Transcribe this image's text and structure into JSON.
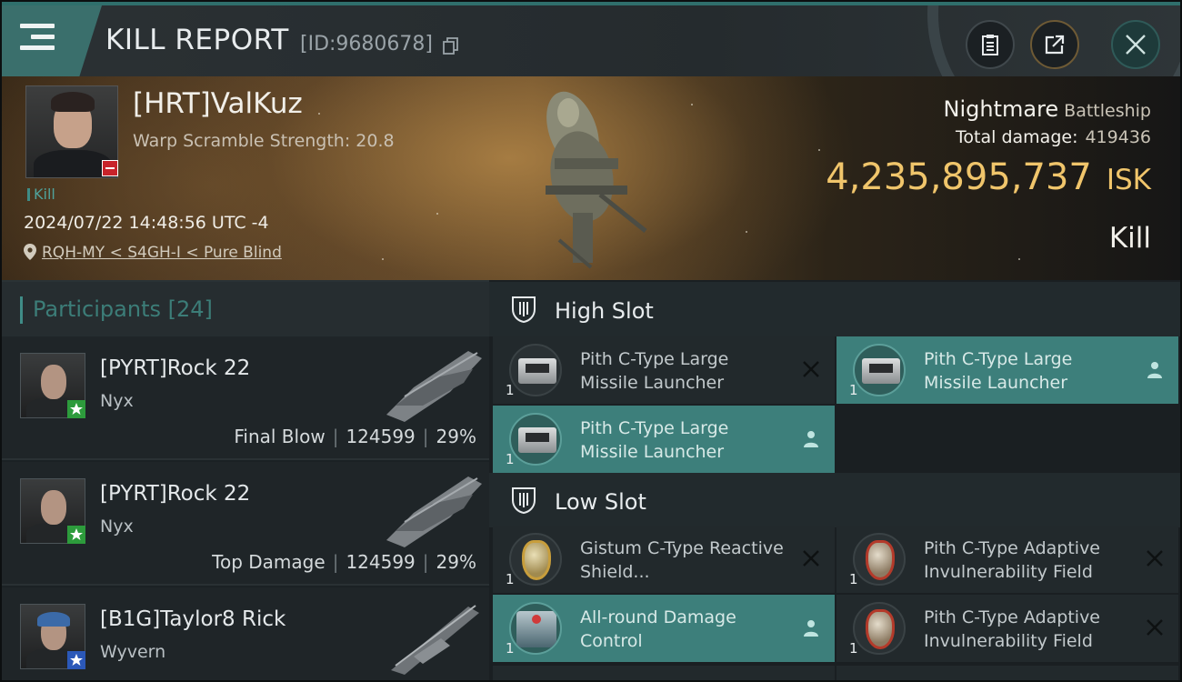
{
  "header": {
    "title": "KILL REPORT",
    "report_id": "[ID:9680678]",
    "icons": {
      "menu": "hamburger-menu-icon",
      "copy": "copy-icon",
      "clipboard": "clipboard-icon",
      "share": "share-icon",
      "close": "close-icon"
    }
  },
  "victim": {
    "name": "[HRT]ValKuz",
    "warp_scramble": "Warp Scramble Strength: 20.8",
    "tag": "Kill",
    "datetime": "2024/07/22 14:48:56 UTC -4",
    "location": "RQH-MY < S4GH-I < Pure Blind",
    "ship_name": "Nightmare",
    "ship_class": "Battleship",
    "total_damage_label": "Total damage:",
    "total_damage": "419436",
    "isk_value": "4,235,895,737",
    "isk_unit": "ISK",
    "result": "Kill"
  },
  "participants": {
    "label": "Participants",
    "count": "[24]",
    "rows": [
      {
        "name": "[PYRT]Rock 22",
        "ship": "Nyx",
        "role": "Final Blow",
        "damage": "124599",
        "percent": "29%",
        "badge": "green"
      },
      {
        "name": "[PYRT]Rock 22",
        "ship": "Nyx",
        "role": "Top Damage",
        "damage": "124599",
        "percent": "29%",
        "badge": "green"
      },
      {
        "name": "[B1G]Taylor8 Rick",
        "ship": "Wyvern",
        "role": "",
        "damage": "",
        "percent": "",
        "badge": "blue"
      }
    ],
    "separator": "|"
  },
  "slots": {
    "high": {
      "label": "High Slot",
      "modules": [
        {
          "name": "Pith C-Type Large Missile Launcher",
          "qty": "1",
          "status": "destroyed"
        },
        {
          "name": "Pith C-Type Large Missile Launcher",
          "qty": "1",
          "status": "dropped"
        },
        {
          "name": "Pith C-Type Large Missile Launcher",
          "qty": "1",
          "status": "dropped"
        }
      ]
    },
    "low": {
      "label": "Low Slot",
      "modules": [
        {
          "name": "Gistum C-Type Reactive Shield...",
          "qty": "1",
          "status": "destroyed"
        },
        {
          "name": "Pith C-Type Adaptive Invulnerability Field",
          "qty": "1",
          "status": "destroyed"
        },
        {
          "name": "All-round Damage Control",
          "qty": "1",
          "status": "dropped"
        },
        {
          "name": "Pith C-Type Adaptive Invulnerability Field",
          "qty": "1",
          "status": "destroyed"
        }
      ]
    }
  },
  "colors": {
    "accent": "#3d7f7b",
    "isk": "#f0c56b",
    "badge_red": "#c8232a"
  }
}
